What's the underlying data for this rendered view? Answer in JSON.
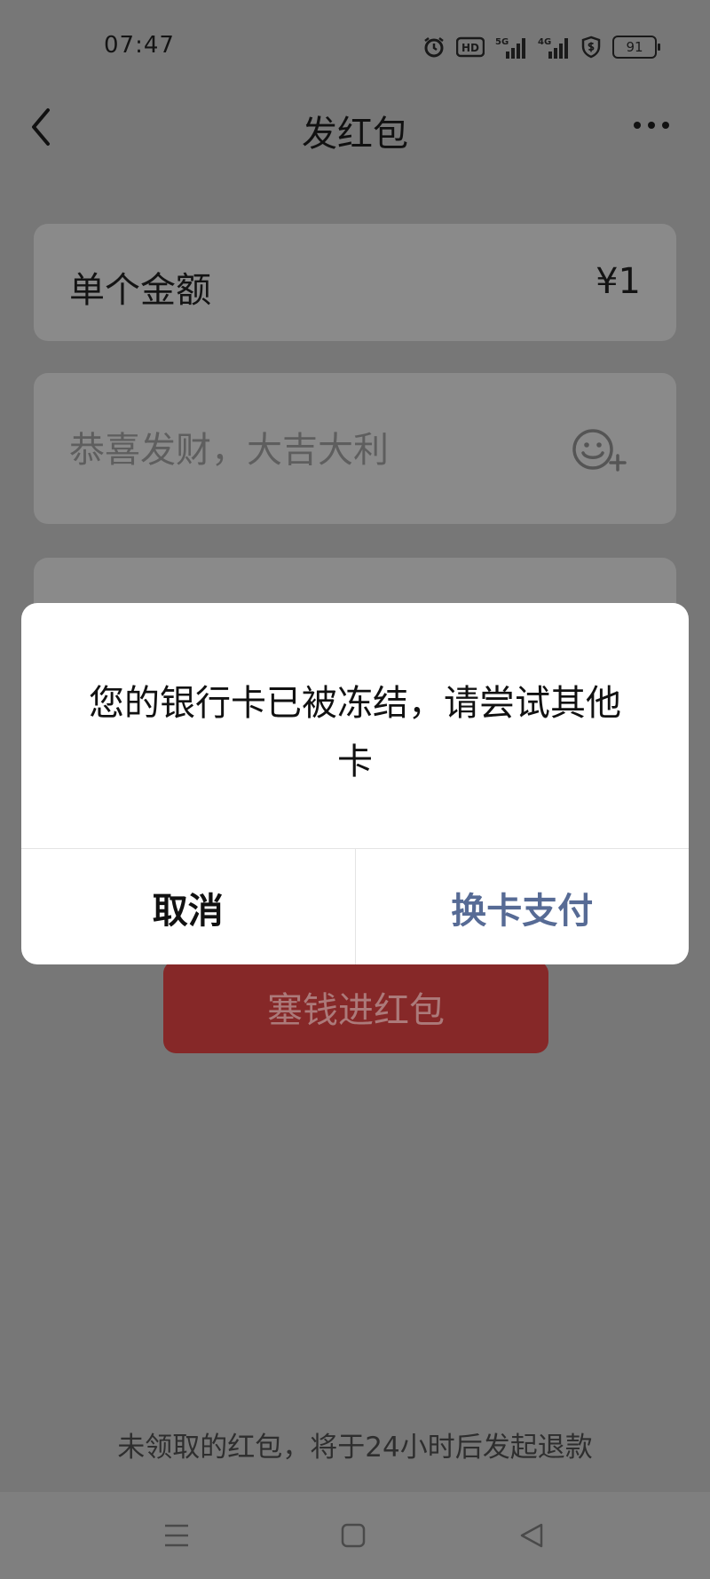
{
  "status_bar": {
    "time": "07:47",
    "hd_label": "HD",
    "net_5g": "5G",
    "net_4g": "4G",
    "battery": "91"
  },
  "header": {
    "title": "发红包"
  },
  "form": {
    "amount_label": "单个金额",
    "amount_value": "¥1",
    "greeting_placeholder": "恭喜发财，大吉大利"
  },
  "send_button_label": "塞钱进红包",
  "footer_note": "未领取的红包，将于24小时后发起退款",
  "dialog": {
    "message": "您的银行卡已被冻结，请尝试其他卡",
    "cancel_label": "取消",
    "confirm_label": "换卡支付"
  },
  "colors": {
    "overlay_background": "#777777",
    "send_button": "#862828",
    "dialog_confirm": "#576b95"
  }
}
